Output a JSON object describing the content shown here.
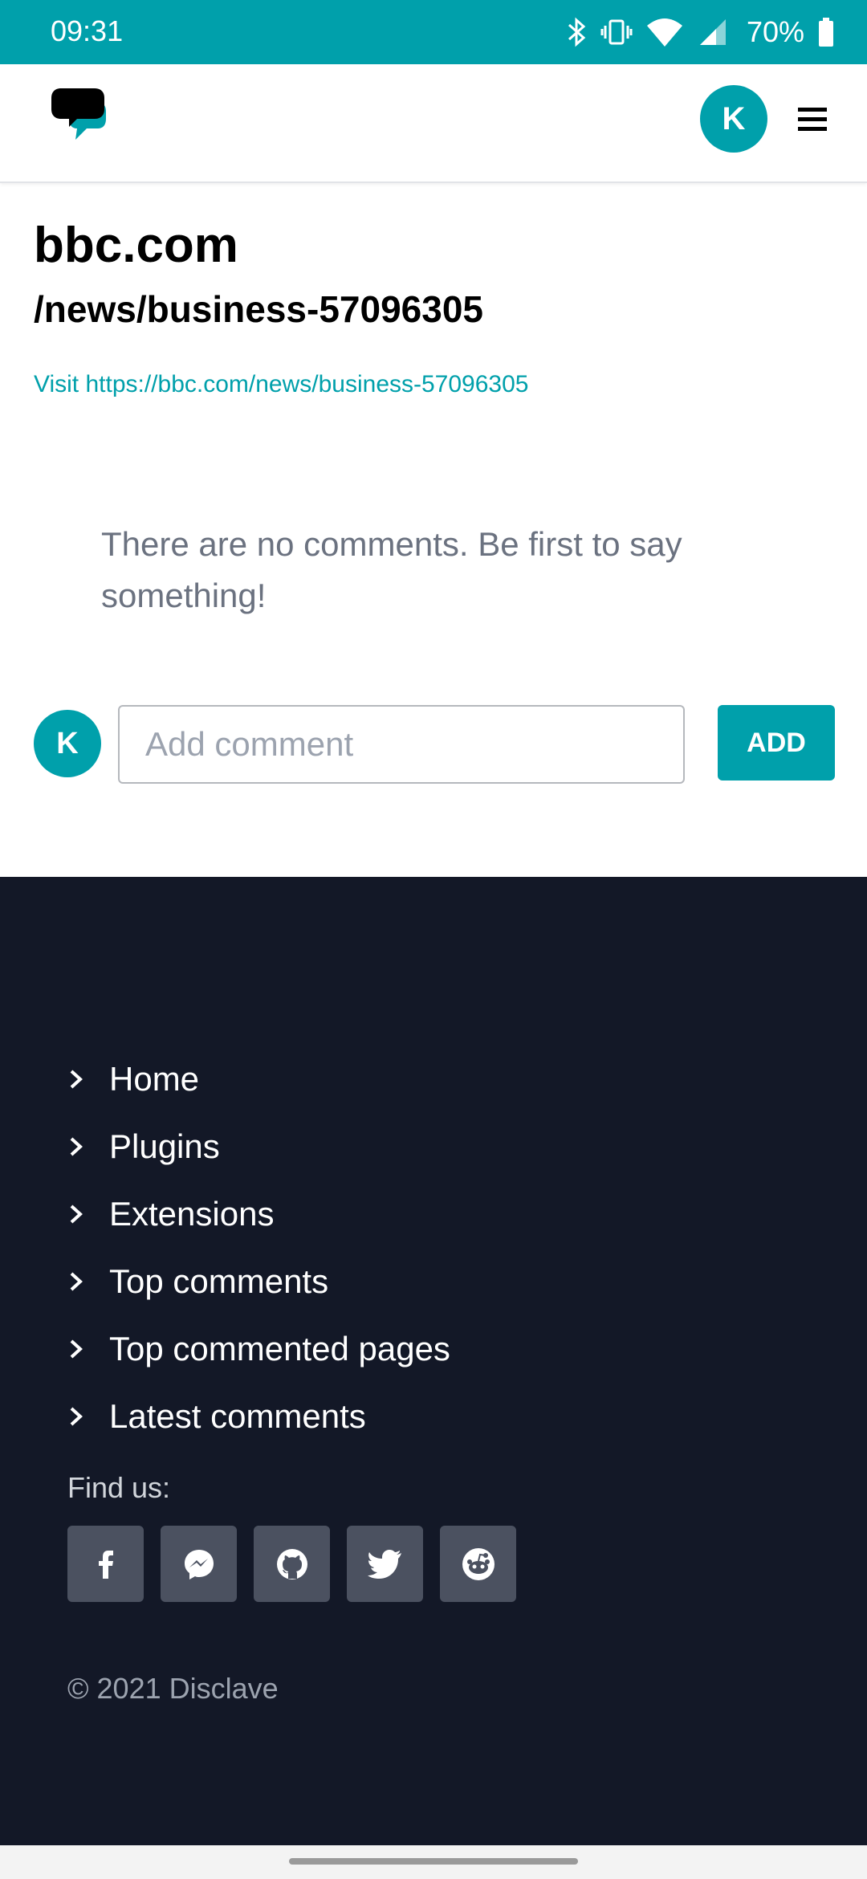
{
  "status_bar": {
    "time": "09:31",
    "battery": "70%",
    "icons": [
      "bluetooth-icon",
      "vibrate-icon",
      "wifi-icon",
      "cell-signal-icon",
      "battery-icon"
    ]
  },
  "header": {
    "logo": "disclave-logo",
    "avatar_initial": "K",
    "menu_icon": "hamburger-menu-icon"
  },
  "page": {
    "site": "bbc.com",
    "path": "/news/business-57096305",
    "visit_link": "Visit https://bbc.com/news/business-57096305"
  },
  "comments": {
    "empty_message": "There are no comments. Be first to say something!",
    "avatar_initial": "K",
    "input_placeholder": "Add comment",
    "add_label": "ADD"
  },
  "footer": {
    "nav": [
      {
        "label": "Home"
      },
      {
        "label": "Plugins"
      },
      {
        "label": "Extensions"
      },
      {
        "label": "Top comments"
      },
      {
        "label": "Top commented pages"
      },
      {
        "label": "Latest comments"
      }
    ],
    "find_us": "Find us:",
    "socials": [
      "facebook-icon",
      "messenger-icon",
      "github-icon",
      "twitter-icon",
      "reddit-icon"
    ],
    "copyright": "© 2021 Disclave"
  },
  "colors": {
    "accent": "#00a0ab",
    "footer_bg": "#131827",
    "social_bg": "#4b5160"
  }
}
